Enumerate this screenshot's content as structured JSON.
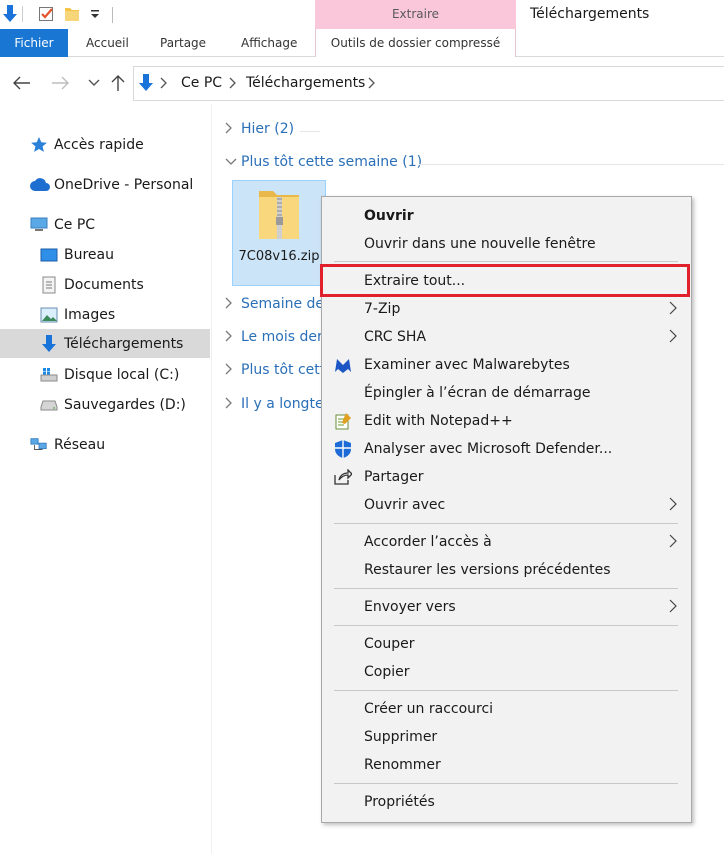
{
  "ribbon": {
    "context_group": "Extraire",
    "window_title": "Téléchargements",
    "tabs": {
      "file": "Fichier",
      "home": "Accueil",
      "share": "Partage",
      "view": "Affichage",
      "compressed_tools": "Outils de dossier compressé"
    }
  },
  "address": {
    "crumbs": [
      "Ce PC",
      "Téléchargements"
    ]
  },
  "sidebar": {
    "items": [
      {
        "label": "Accès rapide"
      },
      {
        "label": "OneDrive - Personal"
      },
      {
        "label": "Ce PC"
      },
      {
        "label": "Bureau"
      },
      {
        "label": "Documents"
      },
      {
        "label": "Images"
      },
      {
        "label": "Téléchargements"
      },
      {
        "label": "Disque local (C:)"
      },
      {
        "label": "Sauvegardes (D:)"
      },
      {
        "label": "Réseau"
      }
    ]
  },
  "content": {
    "groups": [
      {
        "label": "Hier (2)"
      },
      {
        "label": "Plus tôt cette semaine (1)"
      },
      {
        "label": "Semaine der"
      },
      {
        "label": "Le mois dern"
      },
      {
        "label": "Plus tôt cette"
      },
      {
        "label": "Il y a longter"
      }
    ],
    "file": {
      "name": "7C08v16.zip"
    }
  },
  "context_menu": {
    "items": [
      {
        "label": "Ouvrir"
      },
      {
        "label": "Ouvrir dans une nouvelle fenêtre"
      },
      {
        "label": "Extraire tout..."
      },
      {
        "label": "7-Zip"
      },
      {
        "label": "CRC SHA"
      },
      {
        "label": "Examiner avec Malwarebytes"
      },
      {
        "label": "Épingler à l’écran de démarrage"
      },
      {
        "label": "Edit with Notepad++"
      },
      {
        "label": "Analyser avec Microsoft Defender..."
      },
      {
        "label": "Partager"
      },
      {
        "label": "Ouvrir avec"
      },
      {
        "label": "Accorder l’accès à"
      },
      {
        "label": "Restaurer les versions précédentes"
      },
      {
        "label": "Envoyer vers"
      },
      {
        "label": "Couper"
      },
      {
        "label": "Copier"
      },
      {
        "label": "Créer un raccourci"
      },
      {
        "label": "Supprimer"
      },
      {
        "label": "Renommer"
      },
      {
        "label": "Propriétés"
      }
    ]
  },
  "colors": {
    "file_tab": "#1976d2",
    "context_group": "#f9c7d9",
    "highlight_border": "#e0202a",
    "selection": "#cce4f7",
    "group_text": "#2a6fb7"
  }
}
